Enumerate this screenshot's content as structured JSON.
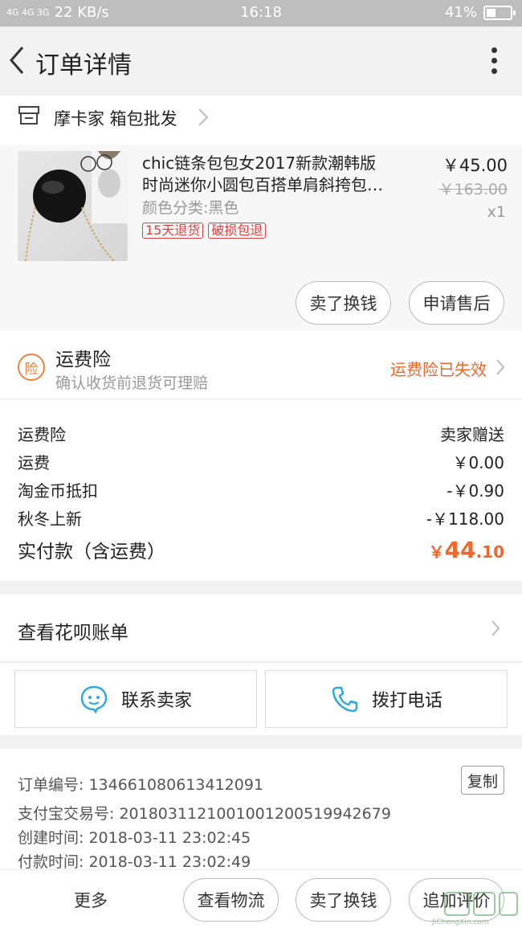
{
  "status_bar": {
    "network": "4G 4G 3G",
    "speed": "22 KB/s",
    "time": "16:18",
    "battery": "41%",
    "battery_level": 0.41
  },
  "header": {
    "title": "订单详情",
    "back_icon": "chevron-left-icon",
    "more_icon": "more-vertical-icon"
  },
  "shop": {
    "name": "摩卡家 箱包批发",
    "icon": "store-icon"
  },
  "product": {
    "title_line1": "chic链条包包女2017新款潮韩版",
    "title_line2": "时尚迷你小圆包百搭单肩斜挎包…",
    "attribute": "颜色分类:黑色",
    "tags": [
      "15天退货",
      "破损包退"
    ],
    "price": "￥45.00",
    "original_price": "￥163.00",
    "quantity": "x1",
    "actions": [
      "卖了换钱",
      "申请售后"
    ]
  },
  "insurance": {
    "badge": "险",
    "title": "运费险",
    "subtitle": "确认收货前退货可理赔",
    "status": "运费险已失效"
  },
  "fees": [
    {
      "label": "运费险",
      "value": "卖家赠送"
    },
    {
      "label": "运费",
      "value": "￥0.00"
    },
    {
      "label": "淘金币抵扣",
      "value": "-￥0.90"
    },
    {
      "label": "秋冬上新",
      "value": "-￥118.00"
    }
  ],
  "total": {
    "label": "实付款（含运费）",
    "currency": "￥",
    "integer": "44",
    "decimal": ".10"
  },
  "huabei": {
    "label": "查看花呗账单"
  },
  "contact": {
    "seller": "联系卖家",
    "call": "拨打电话"
  },
  "order_info": {
    "order_no": "订单编号: 134661080613412091",
    "copy": "复制",
    "alipay_no": "支付宝交易号: 2018031121001001200519942679",
    "created": "创建时间: 2018-03-11 23:02:45",
    "paid": "付款时间: 2018-03-11 23:02:49"
  },
  "bottom_bar": {
    "more": "更多",
    "buttons": [
      "查看物流",
      "卖了换钱",
      "追加评价"
    ]
  },
  "watermark": "JiChengXin.com",
  "colors": {
    "accent": "#f0662a",
    "tag_red": "#e04040",
    "contact_blue": "#2fa8e0"
  }
}
